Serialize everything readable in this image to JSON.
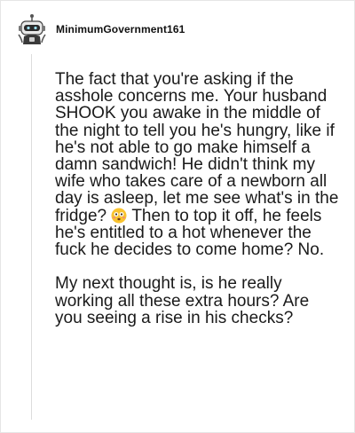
{
  "comment": {
    "username": "MinimumGovernment161",
    "avatar_icon": "snoo-robot-avatar-icon",
    "paragraph1_before_emoji": "The fact that you're asking if the asshole concerns me. Your husband SHOOK you awake in the middle of the night to tell you he's hungry, like if he's not able to go make himself a damn sandwich! He didn't think my wife who takes care of a newborn all day is asleep, let me see what's in the fridge?",
    "emoji_icon": "flushed-face-emoji-icon",
    "paragraph1_after_emoji": "Then to top it off, he feels he's entitled to a hot whenever the fuck he decides to come home? No.",
    "paragraph2": "My next thought is, is he really working all these extra hours? Are you seeing a rise in his checks?"
  },
  "colors": {
    "text": "#1a1a1a",
    "thread_line": "#dcdcdc",
    "emoji_face": "#f9c32f"
  }
}
